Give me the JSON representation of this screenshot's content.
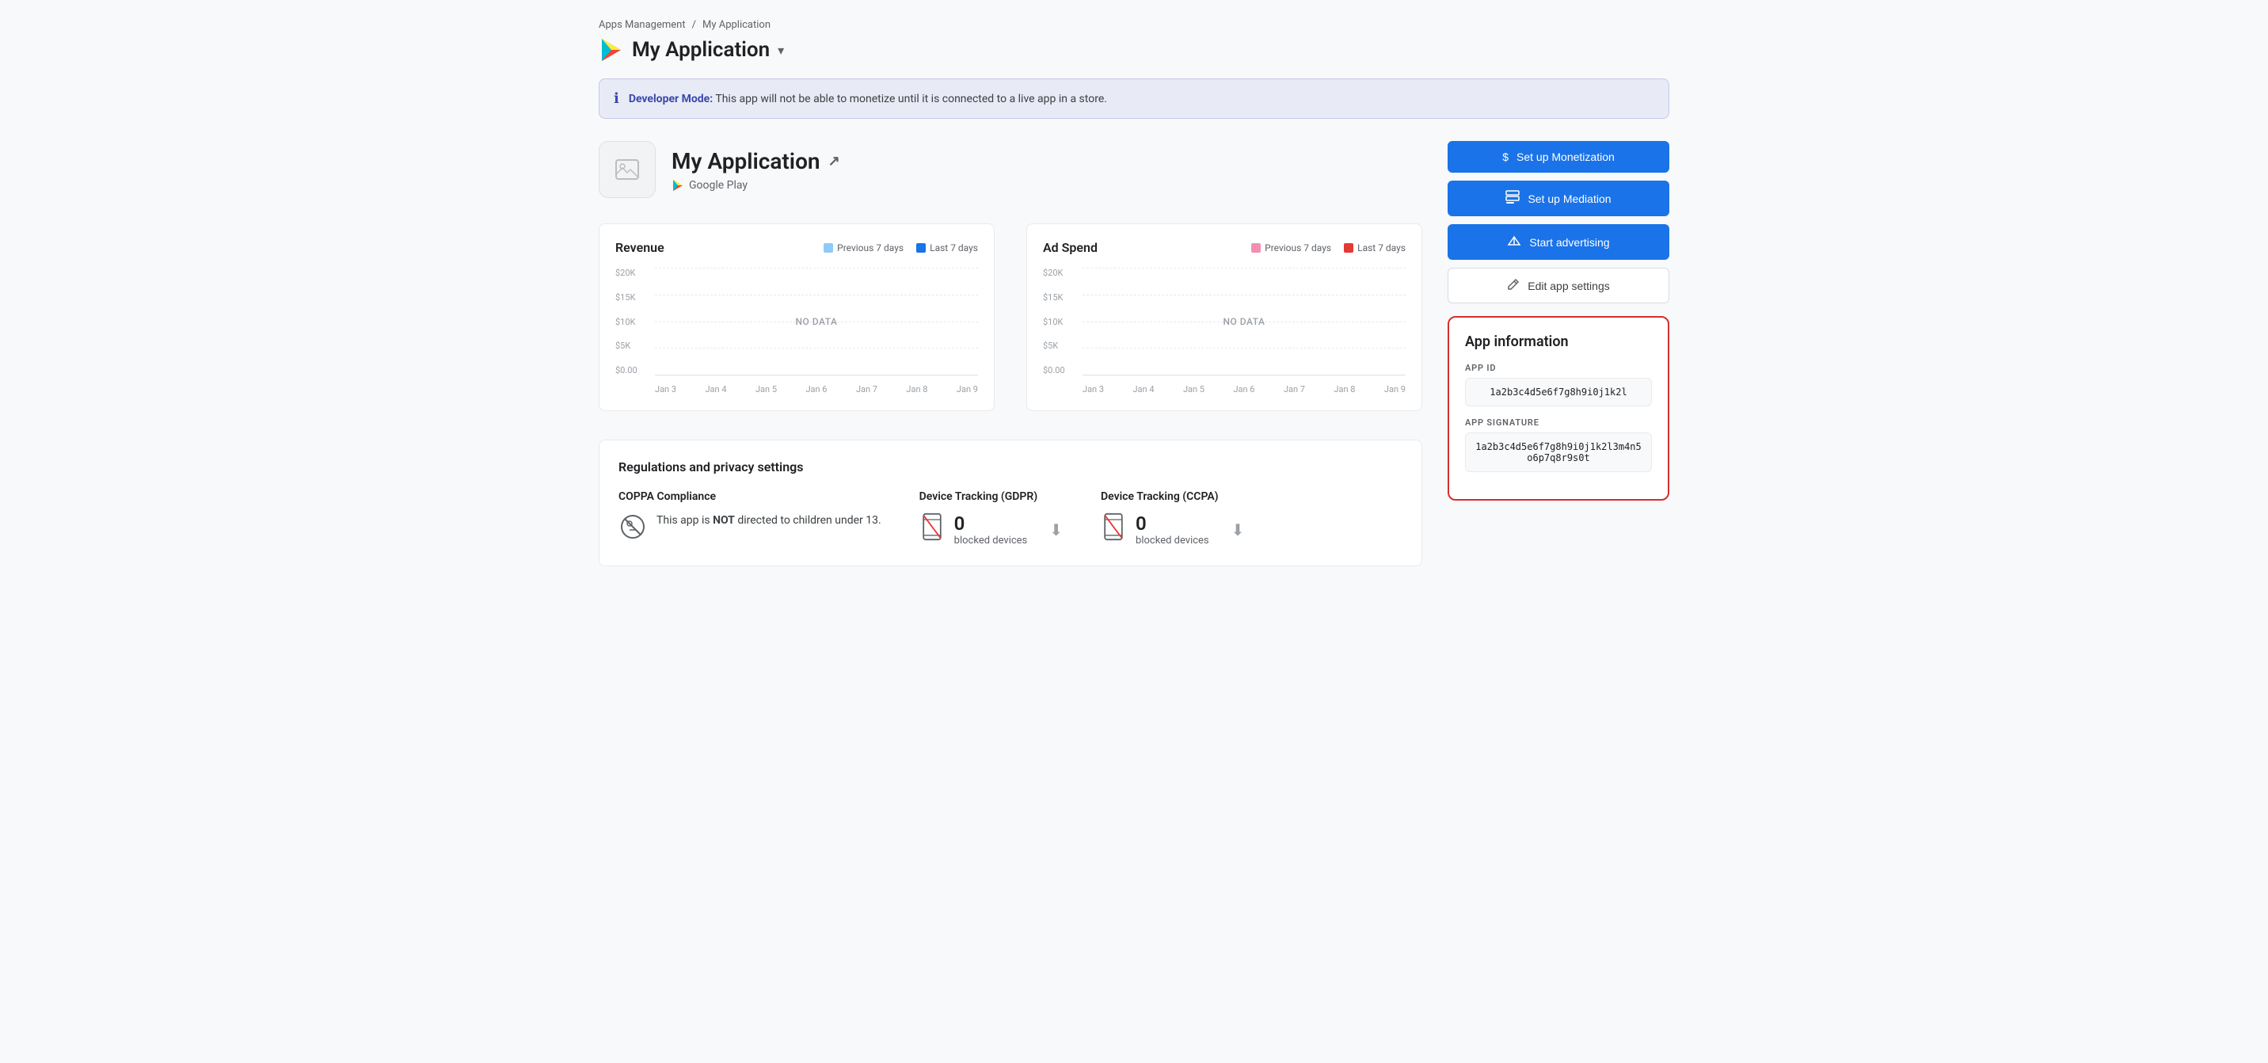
{
  "breadcrumb": {
    "parent": "Apps Management",
    "separator": "/",
    "current": "My Application"
  },
  "header": {
    "app_name": "My Application",
    "chevron": "▾"
  },
  "developer_mode_banner": {
    "text_bold": "Developer Mode:",
    "text_normal": " This app will not be able to monetize until it is connected to a live app in a store."
  },
  "app_section": {
    "name": "My Application",
    "store": "Google Play"
  },
  "revenue_chart": {
    "title": "Revenue",
    "legend_prev": "Previous 7 days",
    "legend_last": "Last 7 days",
    "prev_color": "#90caf9",
    "last_color": "#1a73e8",
    "no_data": "NO DATA",
    "y_labels": [
      "$20K",
      "$15K",
      "$10K",
      "$5K",
      "$0.00"
    ],
    "x_labels": [
      "Jan 3",
      "Jan 4",
      "Jan 5",
      "Jan 6",
      "Jan 7",
      "Jan 8",
      "Jan 9"
    ]
  },
  "adspend_chart": {
    "title": "Ad Spend",
    "legend_prev": "Previous 7 days",
    "legend_last": "Last 7 days",
    "prev_color": "#f48fb1",
    "last_color": "#e53935",
    "no_data": "NO DATA",
    "y_labels": [
      "$20K",
      "$15K",
      "$10K",
      "$5K",
      "$0.00"
    ],
    "x_labels": [
      "Jan 3",
      "Jan 4",
      "Jan 5",
      "Jan 6",
      "Jan 7",
      "Jan 8",
      "Jan 9"
    ]
  },
  "buttons": {
    "set_up_monetization": "Set up Monetization",
    "set_up_mediation": "Set up Mediation",
    "start_advertising": "Start advertising",
    "edit_app_settings": "Edit app settings"
  },
  "app_info_card": {
    "title": "App information",
    "app_id_label": "APP ID",
    "app_id_value": "1a2b3c4d5e6f7g8h9i0j1k2l",
    "app_signature_label": "APP SIGNATURE",
    "app_signature_value": "1a2b3c4d5e6f7g8h9i0j1k2l3m4n5o6p7q8r9s0t"
  },
  "regulations": {
    "title": "Regulations and privacy settings",
    "coppa": {
      "label": "COPPA Compliance",
      "text": "This app is NOT directed to children under 13."
    },
    "gdpr": {
      "label": "Device Tracking (GDPR)",
      "count": "0",
      "unit": "blocked devices"
    },
    "ccpa": {
      "label": "Device Tracking (CCPA)",
      "count": "0",
      "unit": "blocked devices"
    }
  }
}
